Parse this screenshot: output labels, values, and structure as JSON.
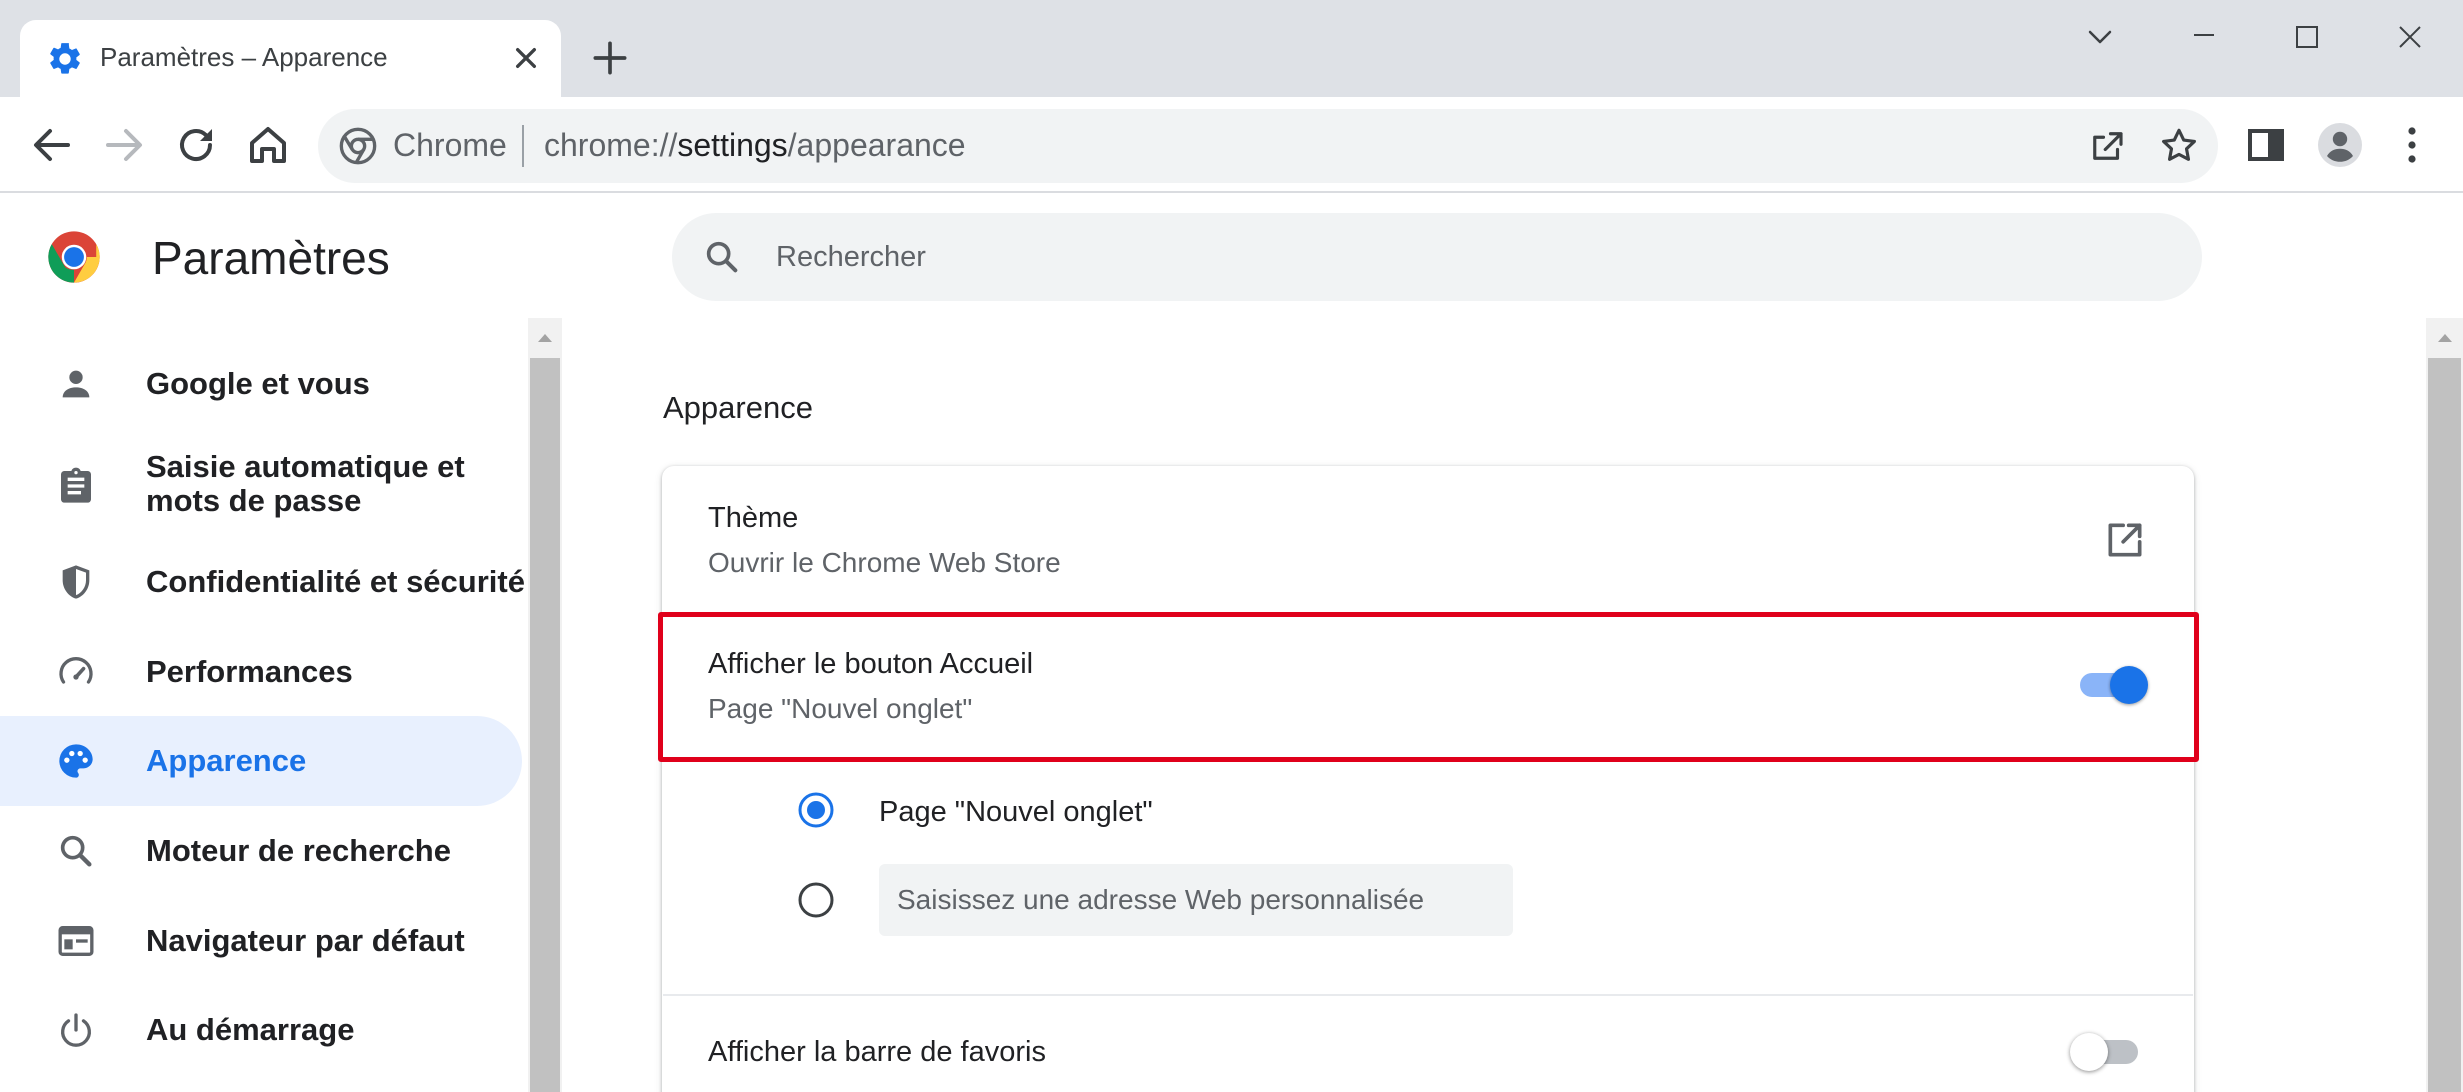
{
  "browser": {
    "tab_title": "Paramètres – Apparence",
    "omnibox_chip": "Chrome",
    "url_scheme": "chrome://",
    "url_host": "settings",
    "url_path": "/appearance"
  },
  "settings": {
    "title": "Paramètres",
    "search_placeholder": "Rechercher"
  },
  "nav": {
    "items": [
      {
        "label": "Google et vous",
        "icon": "person-icon"
      },
      {
        "label": "Saisie automatique et\nmots de passe",
        "icon": "clipboard-icon"
      },
      {
        "label": "Confidentialité et sécurité",
        "icon": "shield-icon"
      },
      {
        "label": "Performances",
        "icon": "speedometer-icon"
      },
      {
        "label": "Apparence",
        "icon": "palette-icon",
        "selected": true
      },
      {
        "label": "Moteur de recherche",
        "icon": "search-icon"
      },
      {
        "label": "Navigateur par défaut",
        "icon": "browser-window-icon"
      },
      {
        "label": "Au démarrage",
        "icon": "power-icon"
      }
    ]
  },
  "main": {
    "section_title": "Apparence",
    "theme": {
      "title": "Thème",
      "subtitle": "Ouvrir le Chrome Web Store"
    },
    "home_button": {
      "title": "Afficher le bouton Accueil",
      "subtitle": "Page \"Nouvel onglet\"",
      "enabled": true
    },
    "home_options": {
      "new_tab_label": "Page \"Nouvel onglet\"",
      "custom_url_placeholder": "Saisissez une adresse Web personnalisée",
      "selected": "new_tab"
    },
    "bookmarks_bar": {
      "title": "Afficher la barre de favoris",
      "enabled": false
    }
  },
  "colors": {
    "accent": "#1a73e8",
    "highlight": "#e0001b",
    "nav_selected_bg": "#e8f0fe"
  }
}
